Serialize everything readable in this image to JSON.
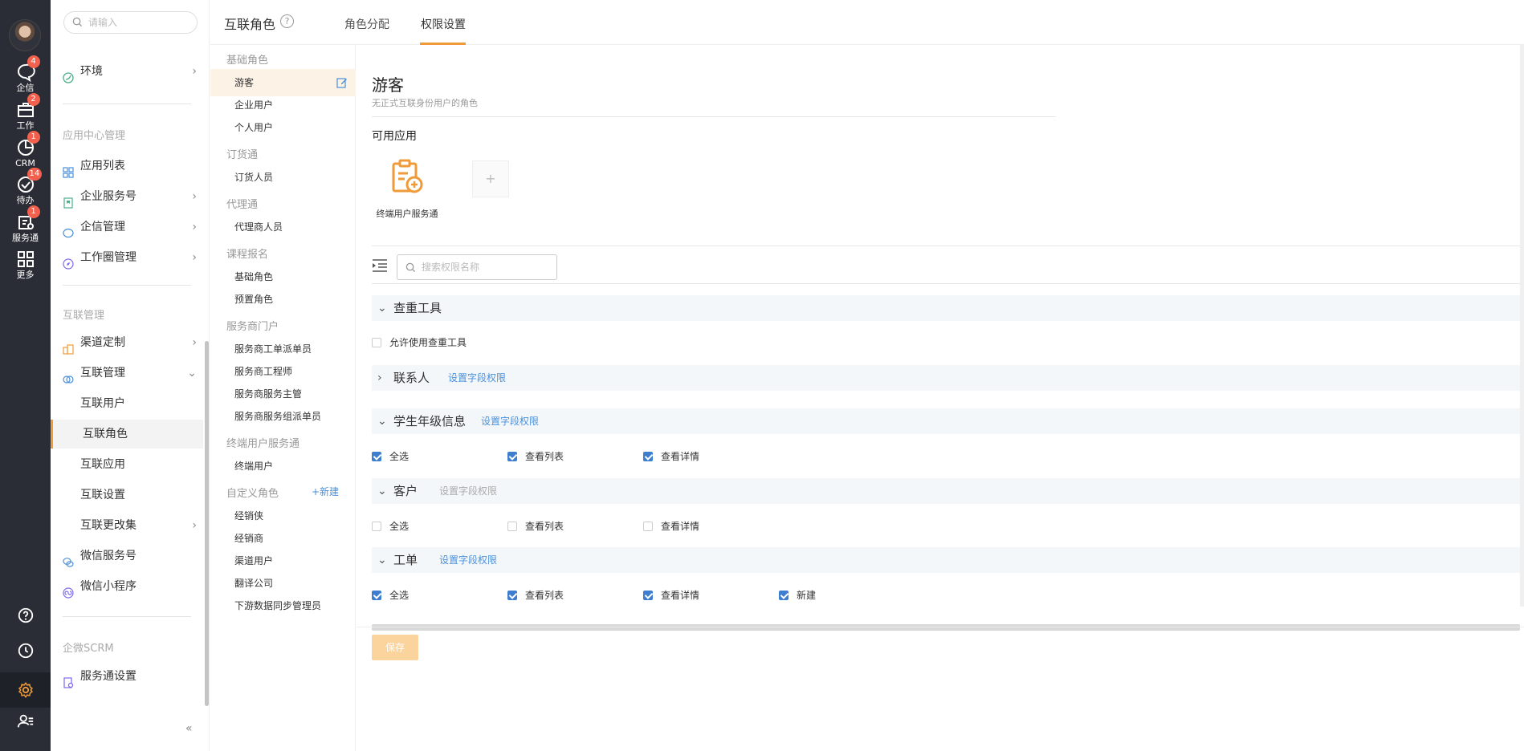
{
  "rail": {
    "items": [
      {
        "label": "企信",
        "badge": "4",
        "icon": "chat-icon"
      },
      {
        "label": "工作",
        "badge": "2",
        "icon": "briefcase-icon"
      },
      {
        "label": "CRM",
        "badge": "1",
        "icon": "pie-chart-icon"
      },
      {
        "label": "待办",
        "badge": "14",
        "icon": "check-circle-icon"
      },
      {
        "label": "服务通",
        "badge": "1",
        "icon": "service-icon"
      },
      {
        "label": "更多",
        "badge": "",
        "icon": "grid-icon"
      }
    ],
    "bottom_icons": [
      "help-icon",
      "clock-icon",
      "gear-icon",
      "user-list-icon"
    ]
  },
  "nav": {
    "search_placeholder": "请输入",
    "items_top": [
      {
        "label": "环境"
      }
    ],
    "section_app": "应用中心管理",
    "app_items": [
      {
        "label": "应用列表"
      },
      {
        "label": "企业服务号"
      },
      {
        "label": "企信管理"
      },
      {
        "label": "工作圈管理"
      }
    ],
    "section_interconnect": "互联管理",
    "ic_items": [
      {
        "label": "渠道定制"
      },
      {
        "label": "互联管理"
      }
    ],
    "ic_sub": [
      "互联用户",
      "互联角色",
      "互联应用",
      "互联设置"
    ],
    "ic_more": [
      {
        "label": "互联更改集"
      },
      {
        "label": "微信服务号"
      },
      {
        "label": "微信小程序"
      }
    ],
    "section_scrm": "企微SCRM",
    "scrm_items": [
      {
        "label": "服务通设置"
      }
    ],
    "collapse": "«"
  },
  "header": {
    "title": "互联角色",
    "help": "?",
    "tabs": [
      "角色分配",
      "权限设置"
    ],
    "active_tab": "权限设置"
  },
  "roles": {
    "groups": [
      {
        "name": "基础角色",
        "items": [
          "游客",
          "企业用户",
          "个人用户"
        ]
      },
      {
        "name": "订货通",
        "items": [
          "订货人员"
        ]
      },
      {
        "name": "代理通",
        "items": [
          "代理商人员"
        ]
      },
      {
        "name": "课程报名",
        "items": [
          "基础角色",
          "预置角色"
        ]
      },
      {
        "name": "服务商门户",
        "items": [
          "服务商工单派单员",
          "服务商工程师",
          "服务商服务主管",
          "服务商服务组派单员"
        ]
      },
      {
        "name": "终端用户服务通",
        "items": [
          "终端用户"
        ]
      },
      {
        "name": "自定义角色",
        "items": [
          "经销侠",
          "经销商",
          "渠道用户",
          "翻译公司",
          "下游数据同步管理员"
        ]
      }
    ],
    "new_label": "+新建",
    "active_role": "游客"
  },
  "main": {
    "role_name": "游客",
    "role_desc": "无正式互联身份用户的角色",
    "apps_title": "可用应用",
    "app_name": "终端用户服务通",
    "add_label": "+",
    "perm_search_placeholder": "搜索权限名称",
    "field_perm_label": "设置字段权限",
    "save_label": "保存",
    "sections": [
      {
        "name": "查重工具",
        "expanded": true,
        "field_link": false,
        "options": [
          {
            "label": "允许使用查重工具",
            "checked": false
          }
        ]
      },
      {
        "name": "联系人",
        "expanded": false,
        "field_link": true,
        "options": []
      },
      {
        "name": "学生年级信息",
        "expanded": true,
        "field_link": true,
        "options": [
          {
            "label": "全选",
            "checked": true
          },
          {
            "label": "查看列表",
            "checked": true
          },
          {
            "label": "查看详情",
            "checked": true
          }
        ]
      },
      {
        "name": "客户",
        "expanded": true,
        "field_link": true,
        "dim": true,
        "options": [
          {
            "label": "全选",
            "checked": false
          },
          {
            "label": "查看列表",
            "checked": false
          },
          {
            "label": "查看详情",
            "checked": false
          }
        ]
      },
      {
        "name": "工单",
        "expanded": true,
        "field_link": true,
        "options": [
          {
            "label": "全选",
            "checked": true
          },
          {
            "label": "查看列表",
            "checked": true
          },
          {
            "label": "查看详情",
            "checked": true
          },
          {
            "label": "新建",
            "checked": true
          }
        ]
      }
    ]
  },
  "colors": {
    "accent": "#f09b39",
    "link": "#4a90d9",
    "rail": "#2a2d36",
    "checkbox": "#3d7ecf"
  }
}
